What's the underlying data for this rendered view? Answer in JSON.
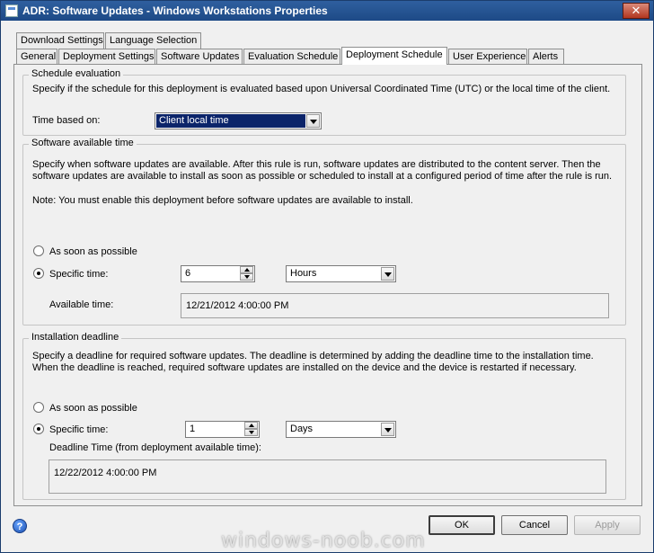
{
  "window": {
    "title": "ADR: Software Updates - Windows Workstations Properties",
    "close_glyph": "✕"
  },
  "tabs_row1": [
    {
      "label": "Download Settings"
    },
    {
      "label": "Language Selection"
    }
  ],
  "tabs_row2": [
    {
      "label": "General"
    },
    {
      "label": "Deployment Settings"
    },
    {
      "label": "Software Updates"
    },
    {
      "label": "Evaluation Schedule"
    },
    {
      "label": "Deployment Schedule",
      "active": true
    },
    {
      "label": "User Experience"
    },
    {
      "label": "Alerts"
    }
  ],
  "schedule_evaluation": {
    "legend": "Schedule evaluation",
    "description": "Specify if the schedule for this deployment is evaluated based upon Universal Coordinated Time (UTC) or the local time of the client.",
    "time_based_label": "Time based on:",
    "time_based_value": "Client local time"
  },
  "software_available": {
    "legend": "Software available time",
    "description": "Specify when software updates are available. After this rule is run, software updates are distributed to the content server. Then the software updates are available to install as soon as possible or scheduled to install at a configured period of time after the rule is run.",
    "note": "Note: You must enable this deployment before software updates are available to install.",
    "asap_label": "As soon as possible",
    "specific_label": "Specific time:",
    "specific_value": "6",
    "unit_value": "Hours",
    "available_label": "Available time:",
    "available_value": "12/21/2012 4:00:00 PM"
  },
  "installation_deadline": {
    "legend": "Installation deadline",
    "description": "Specify a deadline for required software updates. The deadline is determined by adding the deadline time to the installation time. When the deadline is reached, required software updates are installed on the device and the device is restarted if necessary.",
    "asap_label": "As soon as possible",
    "specific_label": "Specific time:",
    "specific_value": "1",
    "unit_value": "Days",
    "deadline_label": "Deadline Time (from deployment available time):",
    "deadline_value": "12/22/2012 4:00:00 PM"
  },
  "buttons": {
    "ok": "OK",
    "cancel": "Cancel",
    "apply": "Apply"
  },
  "help_glyph": "?",
  "watermark": "windows-noob.com"
}
